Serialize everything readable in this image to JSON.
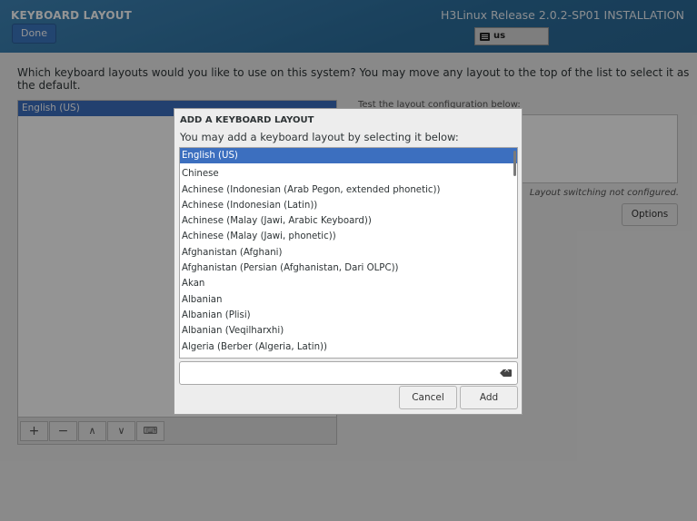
{
  "header": {
    "title": "KEYBOARD LAYOUT",
    "done_label": "Done",
    "product": "H3Linux Release 2.0.2-SP01 INSTALLATION",
    "keyboard_indicator": "us",
    "color": "#2c6f9e"
  },
  "main": {
    "question": "Which keyboard layouts would you like to use on this system?  You may move any layout to the top of the list to select it as the default.",
    "layouts": [
      "English (US)"
    ],
    "toolbar_icons": [
      "plus-icon",
      "minus-icon",
      "arrow-up-icon",
      "arrow-down-icon",
      "keyboard-icon"
    ],
    "test_label": "Test the layout configuration below:",
    "switch_note": "Layout switching not configured.",
    "options_label": "Options"
  },
  "dialog": {
    "title": "ADD A KEYBOARD LAYOUT",
    "subtitle": "You may add a keyboard layout by selecting it below:",
    "selected_index": 0,
    "items": [
      "English (US)",
      "Chinese",
      "Achinese (Indonesian (Arab Pegon, extended phonetic))",
      "Achinese (Indonesian (Latin))",
      "Achinese (Malay (Jawi, Arabic Keyboard))",
      "Achinese (Malay (Jawi, phonetic))",
      "Afghanistan (Afghani)",
      "Afghanistan (Persian (Afghanistan, Dari OLPC))",
      "Akan",
      "Albanian",
      "Albanian (Plisi)",
      "Albanian (Veqilharxhi)",
      "Algeria (Berber (Algeria, Latin))"
    ],
    "search_value": "",
    "cancel_label": "Cancel",
    "add_label": "Add",
    "selection_color": "#3c6fbf"
  }
}
